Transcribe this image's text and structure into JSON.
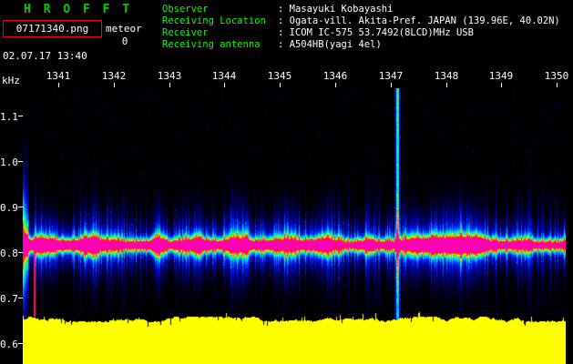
{
  "app": {
    "title": "H R O F F T",
    "filename": "07171340.png",
    "meteor_label": "meteor",
    "meteor_count": "0",
    "datetime": "02.07.17 13:40"
  },
  "header": {
    "fields": [
      {
        "label": "Observer",
        "value": ": Masayuki Kobayashi"
      },
      {
        "label": "Receiving Location",
        "value": ": Ogata-vill. Akita-Pref. JAPAN (139.96E, 40.02N)"
      },
      {
        "label": "Receiver",
        "value": ": ICOM IC-575 53.7492(8LCD)MHz USB"
      },
      {
        "label": "Receiving antenna",
        "value": ": A504HB(yagi 4el)"
      }
    ]
  },
  "colors": {
    "bg": "#000000",
    "title-green": "#00cc00",
    "label-green": "#00ff00",
    "text-white": "#ffffff",
    "box-border-red": "#ff0000",
    "level-yellow": "#ffff00"
  },
  "chart_data": {
    "type": "heatmap",
    "x_axis": {
      "ticks": [
        "1341",
        "1342",
        "1343",
        "1344",
        "1345",
        "1346",
        "1347",
        "1348",
        "1349",
        "1350"
      ]
    },
    "y_axis": {
      "label": "kHz",
      "ticks": [
        "1.1",
        "1.0",
        "0.9",
        "0.8",
        "0.7",
        "0.6"
      ],
      "range": [
        0.556,
        1.162
      ]
    },
    "carrier_band": {
      "center_khz": 0.818,
      "description": "continuous horizontal noise band, blue edges through cyan/green/yellow to red core, with vertical spike texture"
    },
    "events": [
      {
        "time_label": "1347",
        "x_fraction": 0.69,
        "type": "bright vertical streak through full band"
      },
      {
        "time_label": "start",
        "x_fraction": 0.02,
        "type": "start-up transient, red streak below band"
      }
    ],
    "level_meter": {
      "position": "bottom",
      "color": "#ffff00",
      "top_khz": 0.655
    },
    "palette_low_to_high": [
      "#000000",
      "#000078",
      "#001eff",
      "#00b4ff",
      "#00ffdc",
      "#00ff3c",
      "#ffff00",
      "#ff2800",
      "#ff00b4"
    ]
  }
}
